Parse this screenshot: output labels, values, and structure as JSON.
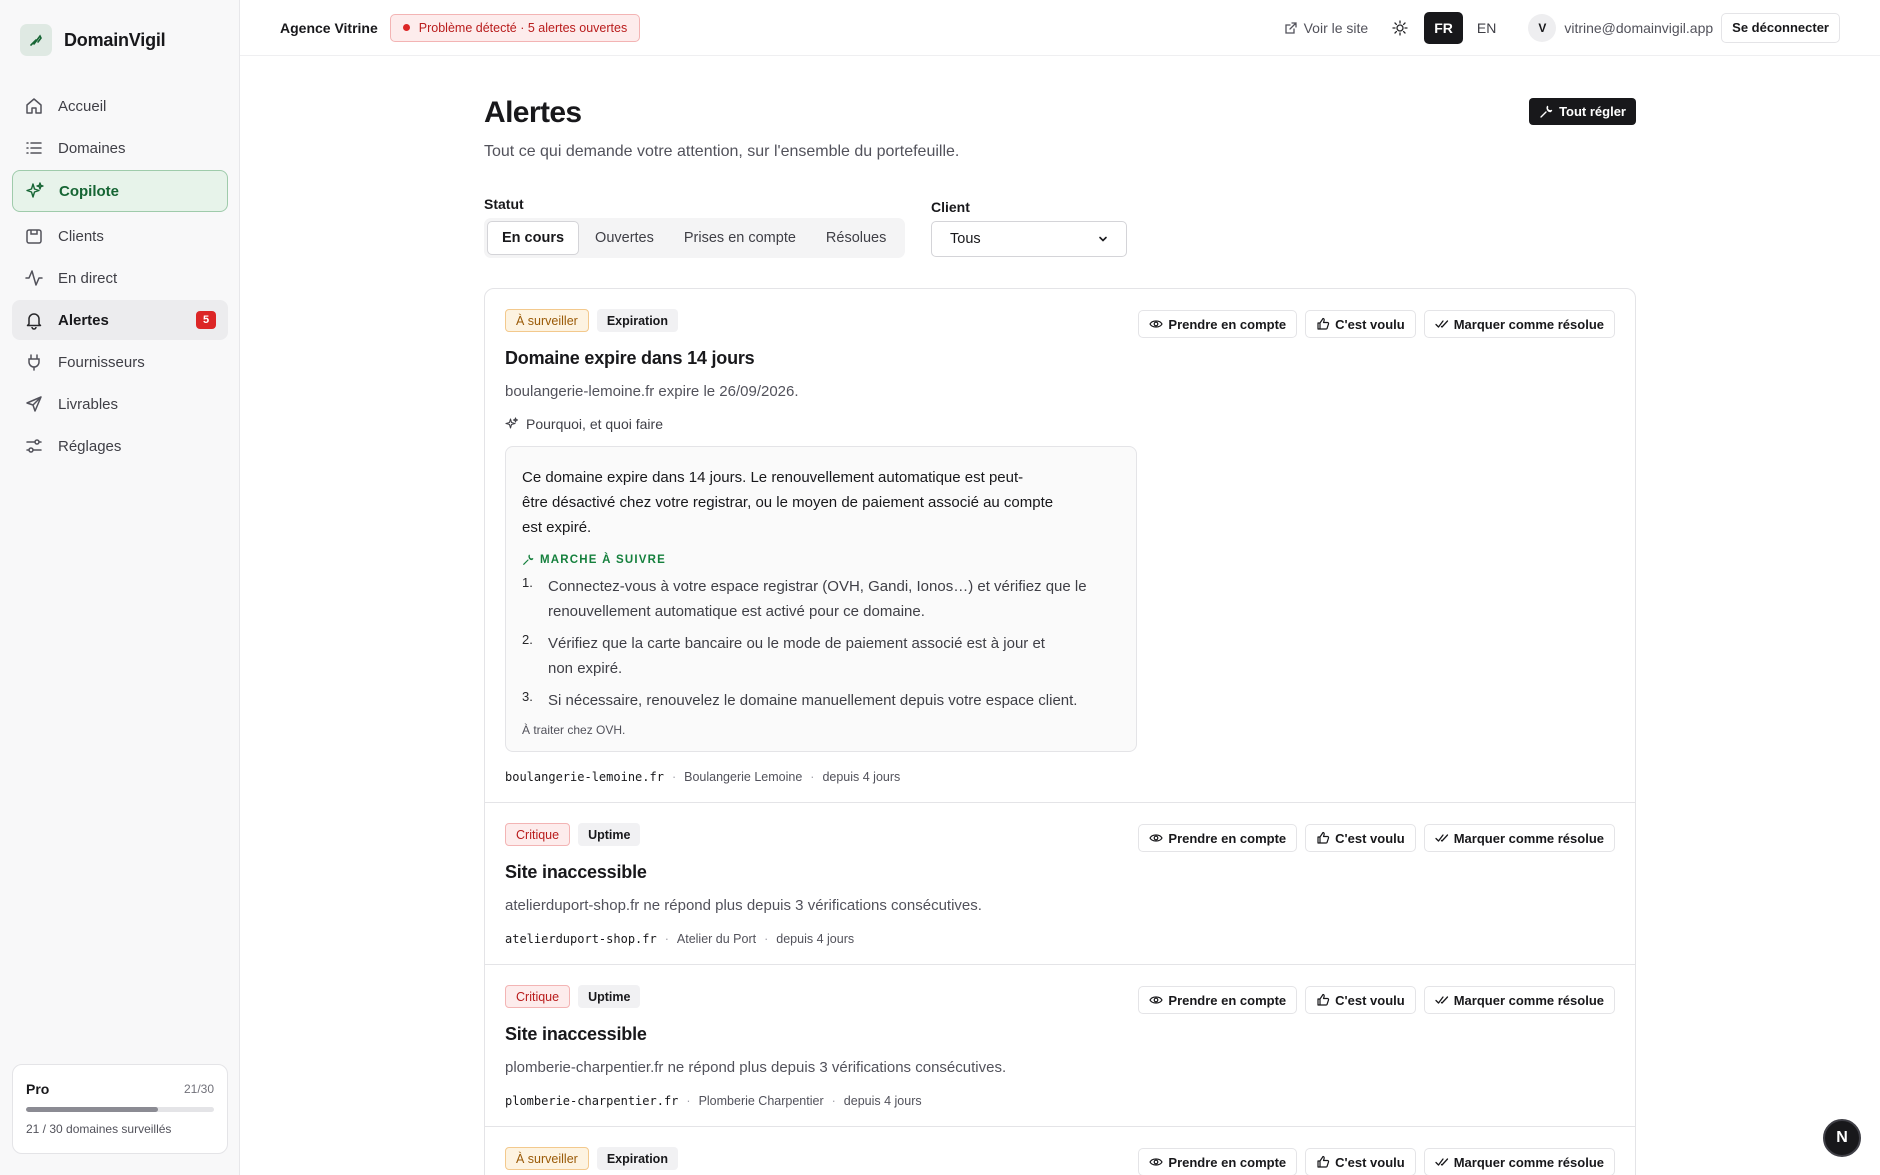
{
  "brand": {
    "name": "DomainVigil"
  },
  "nav": [
    {
      "label": "Accueil",
      "icon": "home-icon"
    },
    {
      "label": "Domaines",
      "icon": "list-icon"
    },
    {
      "label": "Copilote",
      "icon": "sparkle-icon"
    },
    {
      "label": "Clients",
      "icon": "clients-icon"
    },
    {
      "label": "En direct",
      "icon": "activity-icon"
    },
    {
      "label": "Alertes",
      "icon": "bell-icon",
      "badge": "5"
    },
    {
      "label": "Fournisseurs",
      "icon": "plug-icon"
    },
    {
      "label": "Livrables",
      "icon": "send-icon"
    },
    {
      "label": "Réglages",
      "icon": "sliders-icon"
    }
  ],
  "plan": {
    "name": "Pro",
    "count": "21/30",
    "progress_percent": 70,
    "desc": "21 / 30 domaines surveillés"
  },
  "topbar": {
    "agency": "Agence Vitrine",
    "problem": "Problème détecté · 5 alertes ouvertes",
    "view_site": "Voir le site",
    "lang_fr": "FR",
    "lang_en": "EN",
    "avatar": "V",
    "email": "vitrine@domainvigil.app",
    "logout": "Se déconnecter"
  },
  "page": {
    "title": "Alertes",
    "subtitle": "Tout ce qui demande votre attention, sur l'ensemble du portefeuille.",
    "fix_all": "Tout régler"
  },
  "filters": {
    "status_label": "Statut",
    "tabs": [
      "En cours",
      "Ouvertes",
      "Prises en compte",
      "Résolues"
    ],
    "client_label": "Client",
    "client_value": "Tous"
  },
  "actions": {
    "ack": "Prendre en compte",
    "intended": "C'est voulu",
    "resolve": "Marquer comme résolue"
  },
  "alerts": [
    {
      "severity": "À surveiller",
      "category": "Expiration",
      "title": "Domaine expire dans 14 jours",
      "desc": "boulangerie-lemoine.fr expire le 26/09/2026.",
      "why": "Pourquoi, et quoi faire",
      "explain_lines": [
        "Ce domaine expire dans 14 jours. Le renouvellement automatique est peut-",
        "être désactivé chez votre registrar, ou le moyen de paiement associé au compte",
        "est expiré."
      ],
      "steps_title": "MARCHE À SUIVRE",
      "steps": [
        {
          "n": "1.",
          "lines": [
            "Connectez-vous à votre espace registrar (OVH, Gandi, Ionos…) et vérifiez que le",
            "renouvellement automatique est activé pour ce domaine."
          ]
        },
        {
          "n": "2.",
          "lines": [
            "Vérifiez que la carte bancaire ou le mode de paiement associé est à jour et",
            "non expiré."
          ]
        },
        {
          "n": "3.",
          "lines": [
            "Si nécessaire, renouvelez le domaine manuellement depuis votre espace client."
          ]
        }
      ],
      "note": "À traiter chez OVH.",
      "domain": "boulangerie-lemoine.fr",
      "client": "Boulangerie Lemoine",
      "since": "depuis 4 jours"
    },
    {
      "severity": "Critique",
      "category": "Uptime",
      "title": "Site inaccessible",
      "desc": "atelierduport-shop.fr ne répond plus depuis 3 vérifications consécutives.",
      "domain": "atelierduport-shop.fr",
      "client": "Atelier du Port",
      "since": "depuis 4 jours"
    },
    {
      "severity": "Critique",
      "category": "Uptime",
      "title": "Site inaccessible",
      "desc": "plomberie-charpentier.fr ne répond plus depuis 3 vérifications consécutives.",
      "domain": "plomberie-charpentier.fr",
      "client": "Plomberie Charpentier",
      "since": "depuis 4 jours"
    },
    {
      "severity": "À surveiller",
      "category": "Expiration"
    }
  ],
  "fab": {
    "label": "N"
  },
  "colors": {
    "accent_green": "#166534",
    "critical": "#dc2626",
    "warning": "#9a5a07",
    "dark": "#18181b"
  }
}
